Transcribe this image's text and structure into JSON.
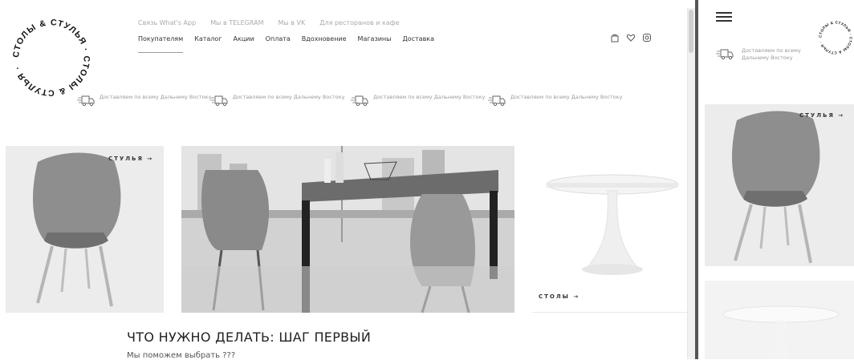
{
  "logo": {
    "text": "СТОЛЫ & СТУЛЬЯ · СТОЛЫ & СТУЛЬЯ ·"
  },
  "top_links": [
    "Связь What's App",
    "Мы в TELEGRAM",
    "Мы в VK",
    "Для ресторанов и кафе"
  ],
  "main_nav": [
    "Покупателям",
    "Каталог",
    "Акции",
    "Оплата",
    "Вдохновение",
    "Магазины",
    "Доставка"
  ],
  "header_icons": [
    "bag-icon",
    "heart-icon",
    "instagram-icon"
  ],
  "delivery_items": [
    "Доставляем по всему Дальнему Востоку",
    "Доставляем по всему Дальнему Востоку",
    "Доставляем по всему Дальнему Востоку",
    "Доставляем по всему Дальнему Востоку"
  ],
  "panels": {
    "chairs_label": "СТУЛЬЯ →",
    "tables_label": "СТОЛЫ →"
  },
  "heading": "ЧТО НУЖНО ДЕЛАТЬ: ШАГ ПЕРВЫЙ",
  "subheading": "Мы поможем выбрать ???",
  "mobile": {
    "logo_text": "СТОЛЫ & СТУЛЬЯ · СТОЛЫ & СТУЛЬЯ ·",
    "delivery_text": "Доставляем по всему Дальнему Востоку",
    "chairs_label": "СТУЛЬЯ →"
  }
}
